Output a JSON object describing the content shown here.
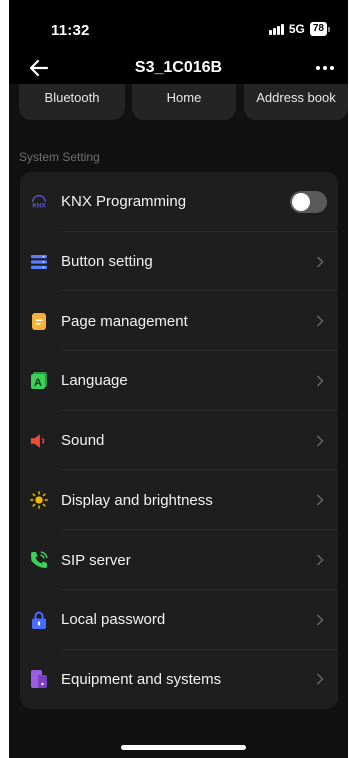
{
  "status_bar": {
    "time": "11:32",
    "network": "5G",
    "battery": "78"
  },
  "header": {
    "title": "S3_1C016B"
  },
  "shortcuts": [
    {
      "label": "Bluetooth"
    },
    {
      "label": "Home"
    },
    {
      "label": "Address book"
    }
  ],
  "section": {
    "label": "System Setting"
  },
  "settings": [
    {
      "label": "KNX Programming",
      "icon": "knx-icon",
      "control": "toggle",
      "enabled": false
    },
    {
      "label": "Button setting",
      "icon": "list-icon",
      "control": "chevron"
    },
    {
      "label": "Page management",
      "icon": "document-icon",
      "control": "chevron"
    },
    {
      "label": "Language",
      "icon": "language-icon",
      "control": "chevron"
    },
    {
      "label": "Sound",
      "icon": "speaker-icon",
      "control": "chevron"
    },
    {
      "label": "Display and brightness",
      "icon": "sun-icon",
      "control": "chevron"
    },
    {
      "label": "SIP server",
      "icon": "phone-icon",
      "control": "chevron"
    },
    {
      "label": "Local password",
      "icon": "lock-icon",
      "control": "chevron"
    },
    {
      "label": "Equipment and systems",
      "icon": "device-icon",
      "control": "chevron"
    }
  ],
  "colors": {
    "background": "#111111",
    "card": "#1e1e1e",
    "knx_icon": "#5b5bd6",
    "list_icon": "#5a7cff",
    "document_icon": "#f5b23a",
    "language_icon": "#3ecf5a",
    "speaker_icon": "#f04a3a",
    "sun_icon": "#f5b800",
    "phone_icon": "#3ecf5a",
    "lock_icon": "#4a6cff",
    "device_icon": "#9a5ce0"
  }
}
